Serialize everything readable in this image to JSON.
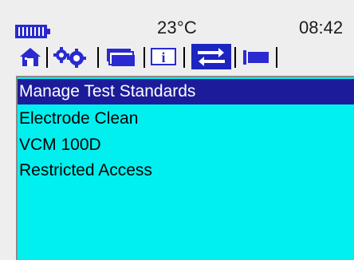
{
  "status": {
    "temperature": "23°C",
    "time": "08:42",
    "battery_level": 1.0
  },
  "tabs": [
    {
      "icon": "home-icon",
      "active": false
    },
    {
      "icon": "gears-icon",
      "active": false
    },
    {
      "icon": "folders-icon",
      "active": false
    },
    {
      "icon": "info-icon",
      "active": false
    },
    {
      "icon": "transfer-icon",
      "active": true
    },
    {
      "icon": "flag-icon",
      "active": false
    }
  ],
  "menu": {
    "items": [
      {
        "label": "Manage Test Standards",
        "selected": true
      },
      {
        "label": "Electrode Clean",
        "selected": false
      },
      {
        "label": "VCM 100D",
        "selected": false
      },
      {
        "label": "Restricted Access",
        "selected": false
      }
    ]
  },
  "colors": {
    "screen_bg": "#00f0f0",
    "selection_bg": "#1c1c9a",
    "active_tab_bg": "#1c25c0",
    "accent": "#2a2ad0"
  }
}
